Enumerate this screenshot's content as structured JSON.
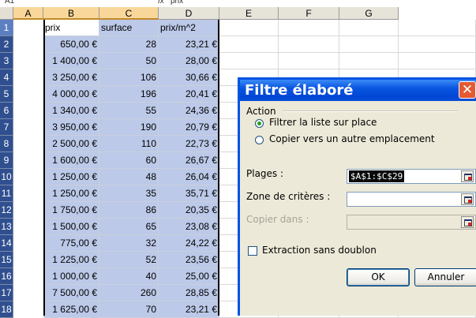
{
  "formula_bar": {
    "name_box": "A1",
    "fx": "fx",
    "value": "prix"
  },
  "columns": [
    "A",
    "B",
    "C",
    "D",
    "E",
    "F",
    "G"
  ],
  "rows": [
    {
      "n": "1",
      "a": "prix",
      "b": "surface",
      "c": "prix/m^2"
    },
    {
      "n": "2",
      "a": "650,00 €",
      "b": "28",
      "c": "23,21 €"
    },
    {
      "n": "3",
      "a": "1 400,00 €",
      "b": "50",
      "c": "28,00 €"
    },
    {
      "n": "4",
      "a": "3 250,00 €",
      "b": "106",
      "c": "30,66 €"
    },
    {
      "n": "5",
      "a": "4 000,00 €",
      "b": "196",
      "c": "20,41 €"
    },
    {
      "n": "6",
      "a": "1 340,00 €",
      "b": "55",
      "c": "24,36 €"
    },
    {
      "n": "7",
      "a": "3 950,00 €",
      "b": "190",
      "c": "20,79 €"
    },
    {
      "n": "8",
      "a": "2 500,00 €",
      "b": "110",
      "c": "22,73 €"
    },
    {
      "n": "9",
      "a": "1 600,00 €",
      "b": "60",
      "c": "26,67 €"
    },
    {
      "n": "10",
      "a": "1 250,00 €",
      "b": "48",
      "c": "26,04 €"
    },
    {
      "n": "11",
      "a": "1 250,00 €",
      "b": "35",
      "c": "35,71 €"
    },
    {
      "n": "12",
      "a": "1 750,00 €",
      "b": "86",
      "c": "20,35 €"
    },
    {
      "n": "13",
      "a": "1 500,00 €",
      "b": "65",
      "c": "23,08 €"
    },
    {
      "n": "14",
      "a": "775,00 €",
      "b": "32",
      "c": "24,22 €"
    },
    {
      "n": "15",
      "a": "1 225,00 €",
      "b": "52",
      "c": "23,56 €"
    },
    {
      "n": "16",
      "a": "1 000,00 €",
      "b": "40",
      "c": "25,00 €"
    },
    {
      "n": "17",
      "a": "7 500,00 €",
      "b": "260",
      "c": "28,85 €"
    },
    {
      "n": "18",
      "a": "1 625,00 €",
      "b": "70",
      "c": "23,21 €"
    }
  ],
  "dialog": {
    "title": "Filtre élaboré",
    "action_label": "Action",
    "radio_inplace": "Filtrer la liste sur place",
    "radio_copy": "Copier vers un autre emplacement",
    "plages_label": "Plages :",
    "plages_value": "$A$1:$C$29",
    "criteres_label": "Zone de critères :",
    "criteres_value": "",
    "copier_label": "Copier dans :",
    "copier_value": "",
    "checkbox_label": "Extraction sans doublon",
    "ok_label": "OK",
    "cancel_label": "Annuler"
  },
  "colors": {
    "titlebar": "#0054e3",
    "selection": "#bcc9e8",
    "row_header": "#2f4f8f"
  }
}
